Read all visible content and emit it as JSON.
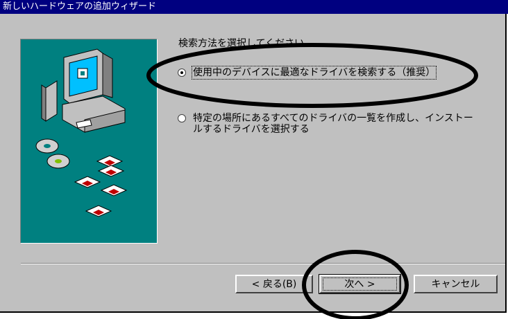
{
  "window": {
    "title": "新しいハードウェアの追加ウィザード"
  },
  "wizard": {
    "prompt": "検索方法を選択してください。",
    "options": [
      {
        "label": "使用中のデバイスに最適なドライバを検索する（推奨）",
        "selected": true
      },
      {
        "label": "特定の場所にあるすべてのドライバの一覧を作成し、インストールするドライバを選択する",
        "selected": false
      }
    ]
  },
  "buttons": {
    "back": "< 戻る(B)",
    "next": "次へ >",
    "cancel": "キャンセル"
  },
  "colors": {
    "titlebar": "#000080",
    "illustration_bg": "#008080",
    "face": "#c0c0c0",
    "annotation": "#000000"
  }
}
